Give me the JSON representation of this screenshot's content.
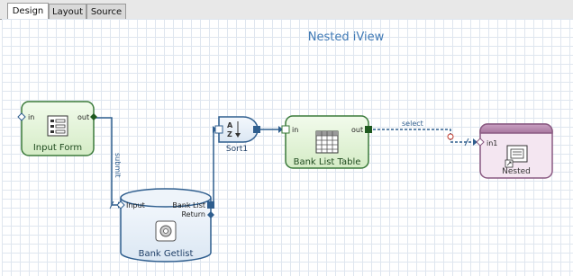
{
  "tabs": [
    {
      "label": "Design",
      "active": true
    },
    {
      "label": "Layout",
      "active": false
    },
    {
      "label": "Source",
      "active": false
    }
  ],
  "canvas_title": "Nested iView",
  "nodes": {
    "input_form": {
      "title": "Input Form",
      "port_in": "in",
      "port_out": "out",
      "icon": "form-icon"
    },
    "bank_getlist": {
      "title": "Bank Getlist",
      "port_input": "Input",
      "port_bank_list": "Bank List",
      "port_return": "Return",
      "icon": "bapi-icon"
    },
    "sort1": {
      "title": "Sort1",
      "icon": "sort-az-icon"
    },
    "bank_list_table": {
      "title": "Bank List Table",
      "port_in": "in",
      "port_out": "out",
      "icon": "table-grid-icon"
    },
    "nested": {
      "title": "Nested",
      "port_in": "in1",
      "icon": "nested-iview-icon"
    }
  },
  "connections": {
    "submit": "submit",
    "select": "select"
  },
  "colors": {
    "accent_blue": "#2f5e8e",
    "title_blue": "#3f79b5",
    "green_border": "#3a7a3a",
    "green_fill": "#e4f3d8",
    "purple_header": "#b98bb0",
    "purple_fill": "#f4e6f1"
  }
}
